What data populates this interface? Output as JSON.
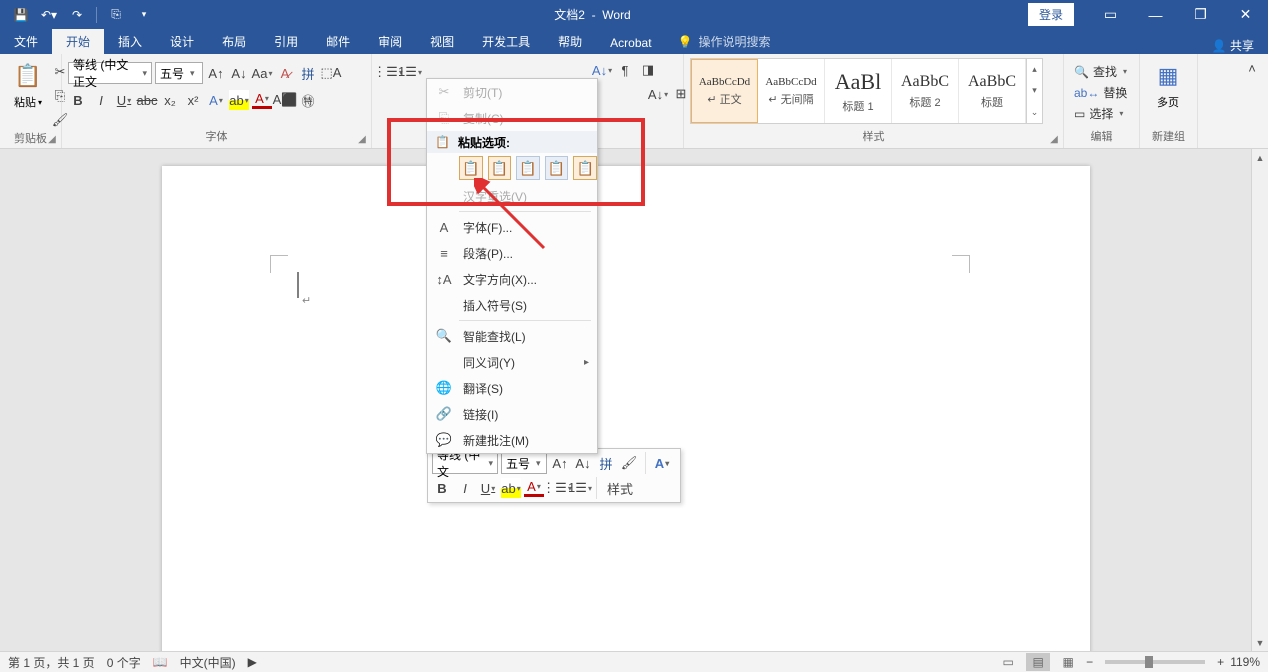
{
  "title": {
    "doc": "文档2",
    "app": "Word"
  },
  "title_buttons": {
    "login": "登录"
  },
  "tabs": [
    "文件",
    "开始",
    "插入",
    "设计",
    "布局",
    "引用",
    "邮件",
    "审阅",
    "视图",
    "开发工具",
    "帮助",
    "Acrobat"
  ],
  "active_tab": "开始",
  "tell_me": "操作说明搜索",
  "share": "共享",
  "groups": {
    "clipboard": {
      "label": "剪贴板",
      "paste": "粘贴"
    },
    "font": {
      "label": "字体",
      "font_name": "等线 (中文正文",
      "font_size": "五号",
      "buttons": [
        "B",
        "I",
        "U",
        "abc",
        "x₂",
        "x²"
      ]
    },
    "paragraph": {
      "label": ""
    },
    "styles": {
      "label": "样式",
      "items": [
        {
          "preview": "AaBbCcDd",
          "name": "↵ 正文",
          "size": "11px"
        },
        {
          "preview": "AaBbCcDd",
          "name": "↵ 无间隔",
          "size": "11px"
        },
        {
          "preview": "AaBl",
          "name": "标题 1",
          "size": "22px"
        },
        {
          "preview": "AaBbC",
          "name": "标题 2",
          "size": "16px"
        },
        {
          "preview": "AaBbC",
          "name": "标题",
          "size": "16px"
        }
      ]
    },
    "editing": {
      "label": "编辑",
      "find": "查找",
      "replace": "替换",
      "select": "选择"
    },
    "newgroup": {
      "label": "新建组",
      "multipage": "多页"
    }
  },
  "context_menu": {
    "cut": "剪切(T)",
    "copy": "复制(C)",
    "paste_header": "粘贴选项:",
    "hanzi": "汉字重选(V)",
    "font": "字体(F)...",
    "paragraph": "段落(P)...",
    "textdir": "文字方向(X)...",
    "symbol": "插入符号(S)",
    "smartfind": "智能查找(L)",
    "synonym": "同义词(Y)",
    "translate": "翻译(S)",
    "link": "链接(I)",
    "comment": "新建批注(M)"
  },
  "mini_toolbar": {
    "font_name": "等线 (中文",
    "font_size": "五号",
    "styles": "样式"
  },
  "status": {
    "page": "第 1 页，共 1 页",
    "words": "0 个字",
    "lang": "中文(中国)",
    "zoom": "119%"
  }
}
